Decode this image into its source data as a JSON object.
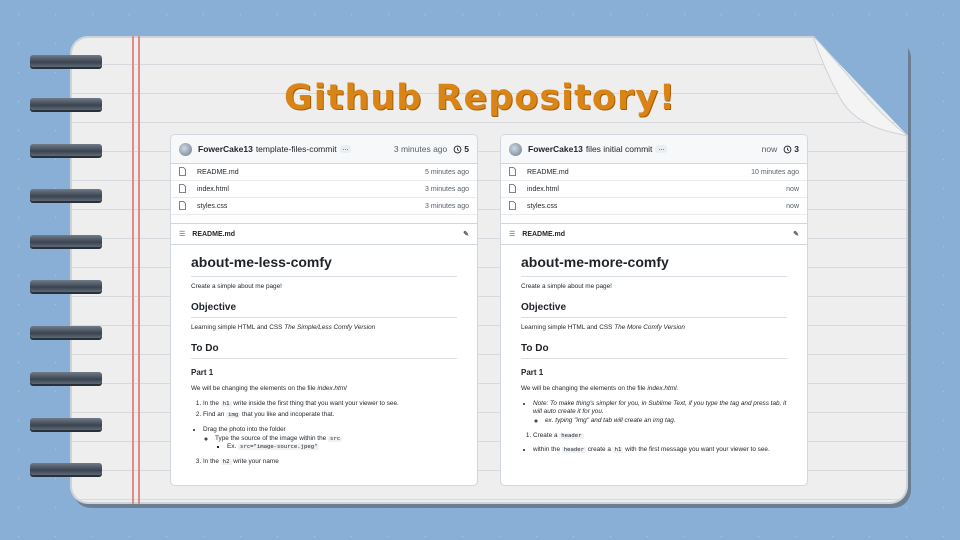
{
  "slide": {
    "title": "Github Repository!"
  },
  "left": {
    "commit": {
      "user": "FowerCake13",
      "message": "template-files-commit",
      "dots": "...",
      "time": "3 minutes ago",
      "history_count": "5"
    },
    "files": [
      {
        "name": "README.md",
        "time": "5 minutes ago"
      },
      {
        "name": "index.html",
        "time": "3 minutes ago"
      },
      {
        "name": "styles.css",
        "time": "3 minutes ago"
      }
    ],
    "readme_label": "README.md",
    "readme": {
      "h1": "about-me-less-comfy",
      "intro": "Create a simple about me page!",
      "objective": "Objective",
      "objective_text": "Learning simple HTML and CSS ",
      "objective_em": "The Simple/Less Comfy Version",
      "todo": "To Do",
      "part1": "Part 1",
      "part1_text": "We will be changing the elements on the file ",
      "part1_file": "index.html",
      "steps": [
        {
          "pre": "In the ",
          "code": "h1",
          "post": " write inside the first thing that you want your viewer to see."
        },
        {
          "pre": "Find an ",
          "code": "img",
          "post": " that you like and incoperate that."
        }
      ],
      "bullet_drag": "Drag the photo into the folder",
      "bullet_type_pre": "Type the source of the image within the ",
      "bullet_type_code": "src",
      "bullet_ex_pre": "Ex. ",
      "bullet_ex_code": "src=\"image-source.jpeg\"",
      "step3_pre": "In the ",
      "step3_code": "h2",
      "step3_post": " write your name"
    }
  },
  "right": {
    "commit": {
      "user": "FowerCake13",
      "message": "files initial commit",
      "dots": "...",
      "time": "now",
      "history_count": "3"
    },
    "files": [
      {
        "name": "README.md",
        "time": "10 minutes ago"
      },
      {
        "name": "index.html",
        "time": "now"
      },
      {
        "name": "styles.css",
        "time": "now"
      }
    ],
    "readme_label": "README.md",
    "readme": {
      "h1": "about-me-more-comfy",
      "intro": "Create a simple about me page!",
      "objective": "Objective",
      "objective_text": "Learning simple HTML and CSS ",
      "objective_em": "The More Comfy Version",
      "todo": "To Do",
      "part1": "Part 1",
      "part1_text": "We will be changing the elements on the file ",
      "part1_file": "index.html.",
      "note": "Note: To make thing's simpler for you, in Sublime Text, if you type the tag and press tab, it will auto create it for you.",
      "note_sub": "ex. typing \"img\" and tab will create an img tag.",
      "step1_pre": "Create a ",
      "step1_code": "header",
      "within_pre": "within the ",
      "within_code1": "header",
      "within_mid": " create a ",
      "within_code2": "h1",
      "within_post": " with the first message you want your viewer to see."
    }
  }
}
